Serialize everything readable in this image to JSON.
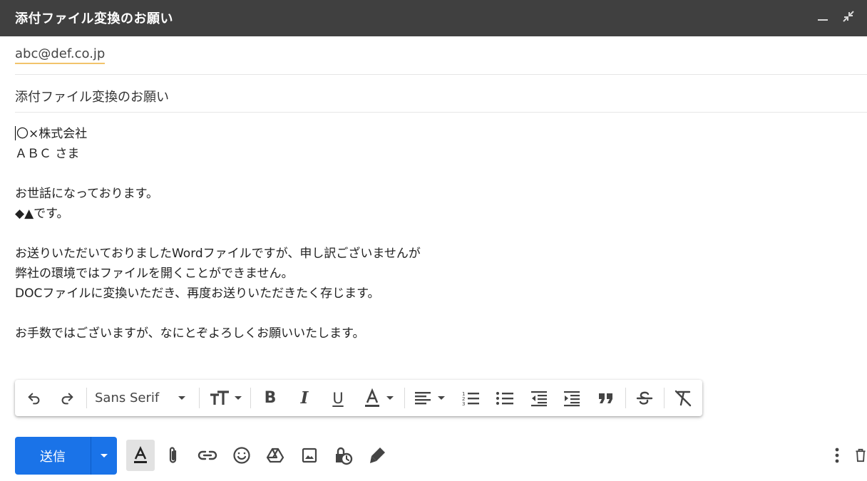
{
  "window": {
    "title": "添付ファイル変換のお願い"
  },
  "compose": {
    "to": "abc@def.co.jp",
    "subject": "添付ファイル変換のお願い",
    "body_lines": [
      "〇×株式会社",
      "ＡＢＣ さま",
      "",
      "お世話になっております。",
      "◆▲です。",
      "",
      "お送りいただいておりましたWordファイルですが、申し訳ございませんが",
      "弊社の環境ではファイルを開くことができません。",
      "DOCファイルに変換いただき、再度お送りいただきたく存じます。",
      "",
      "お手数ではございますが、なにとぞよろしくお願いいたします。"
    ]
  },
  "toolbar": {
    "font_name": "Sans Serif",
    "bold_glyph": "B",
    "italic_glyph": "I",
    "underline_glyph": "U",
    "icons": [
      "undo-icon",
      "redo-icon",
      "font-dropdown-icon",
      "text-size-icon",
      "bold-icon",
      "italic-icon",
      "underline-icon",
      "text-color-icon",
      "align-icon",
      "numbered-list-icon",
      "bulleted-list-icon",
      "indent-less-icon",
      "indent-more-icon",
      "quote-icon",
      "strikethrough-icon",
      "remove-formatting-icon"
    ]
  },
  "actions": {
    "send_label": "送信",
    "icons": [
      "formatting-options-icon",
      "attach-icon",
      "link-icon",
      "emoji-icon",
      "drive-icon",
      "photo-icon",
      "confidential-icon",
      "signature-icon",
      "more-options-icon",
      "discard-icon"
    ]
  },
  "colors": {
    "title_bar": "#404040",
    "send_button": "#1a73e8",
    "recipient_underline": "#f2c46b"
  }
}
